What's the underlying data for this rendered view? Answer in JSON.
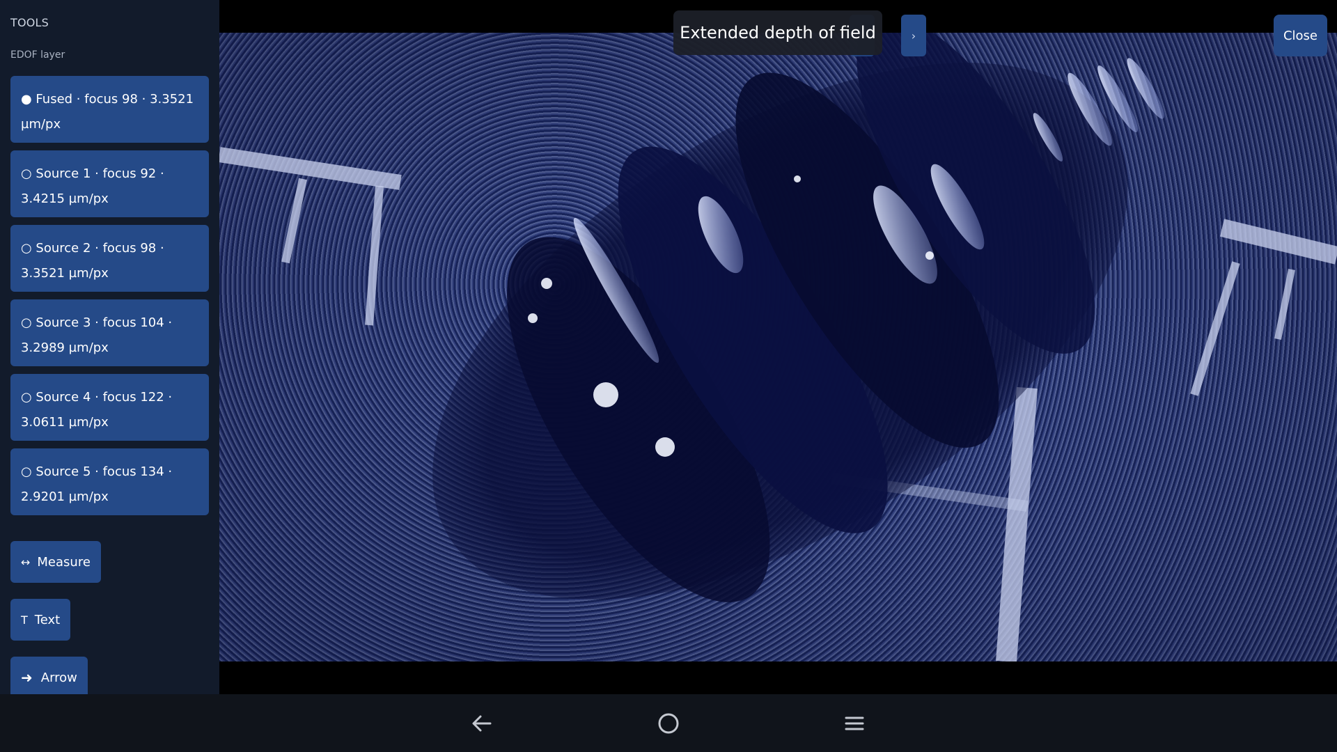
{
  "sidebar": {
    "heading": "TOOLS",
    "subheading": "EDOF layer",
    "layers": [
      {
        "label": "● Fused · focus 98 · 3.3521 µm/px",
        "selected": true
      },
      {
        "label": "○ Source 1 · focus 92 · 3.4215 µm/px",
        "selected": false
      },
      {
        "label": "○ Source 2 · focus 98 · 3.3521 µm/px",
        "selected": false
      },
      {
        "label": "○ Source 3 · focus 104 · 3.2989 µm/px",
        "selected": false
      },
      {
        "label": "○ Source 4 · focus 122 · 3.0611 µm/px",
        "selected": false
      },
      {
        "label": "○ Source 5 · focus 134 · 2.9201 µm/px",
        "selected": false
      }
    ],
    "tools": [
      {
        "icon": "↔",
        "icon_name": "measure-icon",
        "label": "Measure"
      },
      {
        "icon": "T",
        "icon_name": "text-icon",
        "label": "Text"
      },
      {
        "icon": "➜",
        "icon_name": "arrow-icon",
        "label": "Arrow"
      }
    ]
  },
  "viewer": {
    "title": "Extended depth of field",
    "prev_glyph": "‹",
    "next_glyph": "›",
    "close_label": "Close"
  },
  "navbar": {
    "back_icon": "back-icon",
    "home_icon": "home-icon",
    "menu_icon": "menu-icon"
  },
  "colors": {
    "sidebar_bg": "#121b2b",
    "button_blue": "#254a88",
    "navbar_bg": "#10141b"
  }
}
